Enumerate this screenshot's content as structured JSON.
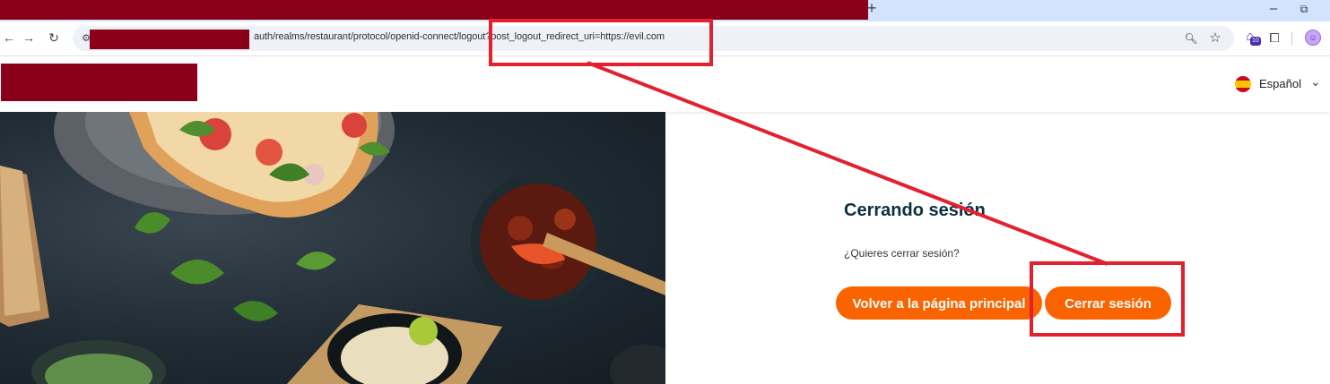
{
  "colors": {
    "redaction": "#8b0019",
    "accent_orange": "#fa6400",
    "annotation_red": "#e4202f",
    "title_navy": "#0d2f3f",
    "tabstrip_bg": "#d3e3fd"
  },
  "browser": {
    "new_tab_label": "+",
    "minimize_label": "–",
    "restore_label": "⧉",
    "url_visible": "auth/realms/restaurant/protocol/openid-connect/logout?post_logout_redirect_uri=https://evil.com",
    "extension_badge_count": "10",
    "icons": {
      "back": "arrow-left-icon",
      "forward": "arrow-right-icon",
      "reload": "reload-icon",
      "site_info": "tune-icon",
      "zoom": "zoom-icon",
      "bookmark": "star-icon",
      "extension": "house-extension-icon",
      "extensions_menu": "puzzle-icon",
      "profile": "avatar-icon"
    }
  },
  "header": {
    "language": {
      "label": "Español",
      "flag": "spain-flag-icon"
    }
  },
  "logout": {
    "title": "Cerrando sesión",
    "question": "¿Quieres cerrar sesión?",
    "back_button": "Volver a la página principal",
    "logout_button": "Cerrar sesión"
  }
}
